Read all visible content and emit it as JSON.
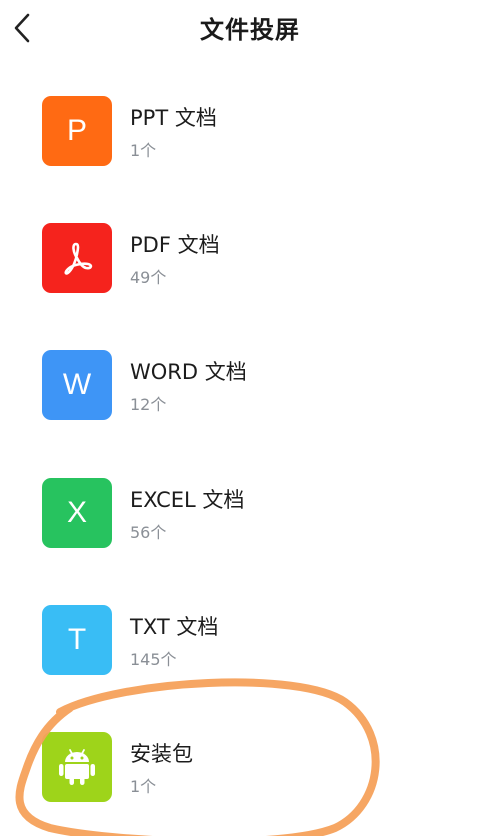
{
  "header": {
    "title": "文件投屏",
    "back_icon": "chevron-left-icon"
  },
  "items": [
    {
      "key": "ppt",
      "name": "PPT 文档",
      "count": "1个",
      "icon_letter": "P",
      "icon": "ppt-file-icon",
      "color": "#ff6a13"
    },
    {
      "key": "pdf",
      "name": "PDF 文档",
      "count": "49个",
      "icon_letter": "",
      "icon": "pdf-acrobat-icon",
      "color": "#f5231d"
    },
    {
      "key": "word",
      "name": "WORD 文档",
      "count": "12个",
      "icon_letter": "W",
      "icon": "word-file-icon",
      "color": "#3e95f6"
    },
    {
      "key": "excel",
      "name": "EXCEL 文档",
      "count": "56个",
      "icon_letter": "X",
      "icon": "excel-file-icon",
      "color": "#27c35f"
    },
    {
      "key": "txt",
      "name": "TXT 文档",
      "count": "145个",
      "icon_letter": "T",
      "icon": "txt-file-icon",
      "color": "#39bdf5"
    },
    {
      "key": "apk",
      "name": "安装包",
      "count": "1个",
      "icon_letter": "",
      "icon": "android-icon",
      "color": "#9ed41a"
    }
  ],
  "annotation": {
    "highlight_color": "#f5a15b"
  }
}
